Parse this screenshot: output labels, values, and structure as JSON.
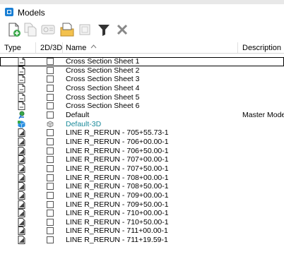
{
  "window": {
    "title": "Models"
  },
  "columns": {
    "type": "Type",
    "dim": "2D/3D",
    "name": "Name",
    "description": "Description"
  },
  "rows": [
    {
      "icon": "sheet-icon",
      "dim": "checkbox",
      "name": "Cross Section Sheet 1",
      "description": "",
      "selected": true
    },
    {
      "icon": "sheet-icon",
      "dim": "checkbox",
      "name": "Cross Section Sheet 2",
      "description": ""
    },
    {
      "icon": "sheet-icon",
      "dim": "checkbox",
      "name": "Cross Section Sheet 3",
      "description": ""
    },
    {
      "icon": "sheet-icon",
      "dim": "checkbox",
      "name": "Cross Section Sheet 4",
      "description": ""
    },
    {
      "icon": "sheet-icon",
      "dim": "checkbox",
      "name": "Cross Section Sheet 5",
      "description": ""
    },
    {
      "icon": "sheet-icon",
      "dim": "checkbox",
      "name": "Cross Section Sheet 6",
      "description": ""
    },
    {
      "icon": "design-model-icon",
      "dim": "checkbox",
      "name": "Default",
      "description": "Master Mode"
    },
    {
      "icon": "3d-model-icon",
      "dim": "3d",
      "name": "Default-3D",
      "description": "",
      "teal": true
    },
    {
      "icon": "drawing-icon",
      "dim": "checkbox",
      "name": "LINE R_RERUN - 705+55.73-1",
      "description": ""
    },
    {
      "icon": "drawing-icon",
      "dim": "checkbox",
      "name": "LINE R_RERUN - 706+00.00-1",
      "description": ""
    },
    {
      "icon": "drawing-icon",
      "dim": "checkbox",
      "name": "LINE R_RERUN - 706+50.00-1",
      "description": ""
    },
    {
      "icon": "drawing-icon",
      "dim": "checkbox",
      "name": "LINE R_RERUN - 707+00.00-1",
      "description": ""
    },
    {
      "icon": "drawing-icon",
      "dim": "checkbox",
      "name": "LINE R_RERUN - 707+50.00-1",
      "description": ""
    },
    {
      "icon": "drawing-icon",
      "dim": "checkbox",
      "name": "LINE R_RERUN - 708+00.00-1",
      "description": ""
    },
    {
      "icon": "drawing-icon",
      "dim": "checkbox",
      "name": "LINE R_RERUN - 708+50.00-1",
      "description": ""
    },
    {
      "icon": "drawing-icon",
      "dim": "checkbox",
      "name": "LINE R_RERUN - 709+00.00-1",
      "description": ""
    },
    {
      "icon": "drawing-icon",
      "dim": "checkbox",
      "name": "LINE R_RERUN - 709+50.00-1",
      "description": ""
    },
    {
      "icon": "drawing-icon",
      "dim": "checkbox",
      "name": "LINE R_RERUN - 710+00.00-1",
      "description": ""
    },
    {
      "icon": "drawing-icon",
      "dim": "checkbox",
      "name": "LINE R_RERUN - 710+50.00-1",
      "description": ""
    },
    {
      "icon": "drawing-icon",
      "dim": "checkbox",
      "name": "LINE R_RERUN - 711+00.00-1",
      "description": ""
    },
    {
      "icon": "drawing-icon",
      "dim": "checkbox",
      "name": "LINE R_RERUN - 711+19.59-1",
      "description": ""
    }
  ]
}
